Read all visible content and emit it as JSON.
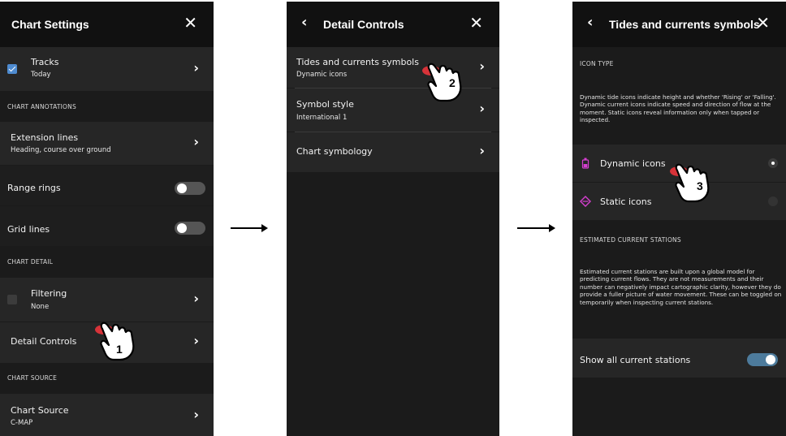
{
  "panel1": {
    "title": "Chart Settings",
    "tracks": {
      "label": "Tracks",
      "sub": "Today"
    },
    "section_annotations": "CHART ANNOTATIONS",
    "extension_lines": {
      "label": "Extension lines",
      "sub": "Heading, course over ground"
    },
    "range_rings": "Range rings",
    "grid_lines": "Grid lines",
    "section_detail": "CHART DETAIL",
    "filtering": {
      "label": "Filtering",
      "sub": "None"
    },
    "detail_controls": "Detail Controls",
    "section_source": "CHART SOURCE",
    "chart_source": {
      "label": "Chart Source",
      "sub": "C-MAP"
    }
  },
  "panel2": {
    "title": "Detail Controls",
    "tides": {
      "label": "Tides and currents symbols",
      "sub": "Dynamic icons"
    },
    "symbol_style": {
      "label": "Symbol style",
      "sub": "International 1"
    },
    "chart_symbology": "Chart symbology"
  },
  "panel3": {
    "title": "Tides and currents symbols",
    "section_icon_type": "ICON TYPE",
    "icon_type_desc": "Dynamic tide icons indicate height and whether 'Rising' or 'Falling'. Dynamic current icons indicate speed and direction of flow at the moment. Static icons reveal information only when tapped or inspected.",
    "dynamic_icons": "Dynamic icons",
    "static_icons": "Static icons",
    "section_estimated": "ESTIMATED CURRENT STATIONS",
    "estimated_desc": "Estimated current stations are built upon a global model for predicting current flows. They are not measurements and their number can negatively impact cartographic clarity, however they do provide a fuller picture of water movement. These can be toggled on temporarily when inspecting current stations.",
    "show_all": "Show all current stations"
  },
  "steps": [
    "1",
    "2",
    "3"
  ],
  "colors": {
    "accent": "#4e8bd0",
    "toggle_on": "#4d7b9c",
    "dynamic_icon": "#d63fd0",
    "static_icon": "#d63fd0",
    "hand_glow": "#e0343a"
  }
}
